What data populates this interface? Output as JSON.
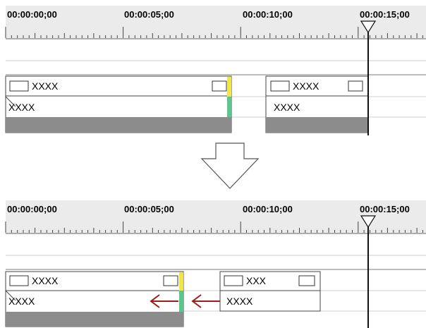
{
  "panels": [
    {
      "timecodes": [
        "00:00:00;00",
        "00:00:05;00",
        "00:00:10;00",
        "00:00:15;00"
      ],
      "clips": [
        {
          "top_label": "XXXX",
          "bottom_label": "XXXX"
        },
        {
          "top_label": "XXXX",
          "bottom_label": "XXXX"
        }
      ]
    },
    {
      "timecodes": [
        "00:00:00;00",
        "00:00:05;00",
        "00:00:10;00",
        "00:00:15;00"
      ],
      "clips": [
        {
          "top_label": "XXXX",
          "bottom_label": "XXXX"
        },
        {
          "top_label": "XXX",
          "bottom_label": "XXXX"
        }
      ]
    }
  ],
  "colors": {
    "ruler_bg": "#ebebeb",
    "track_bg": "#ffffff",
    "clip_bottom_bar": "#8c8c8c",
    "in_marker": "#f0e64b",
    "out_marker": "#5ac88c",
    "playhead": "#111111",
    "arrow": "#9a1e1e"
  },
  "icons": {
    "transition_arrow": "down-arrow-icon",
    "move_arrows": "left-arrow-icon"
  }
}
